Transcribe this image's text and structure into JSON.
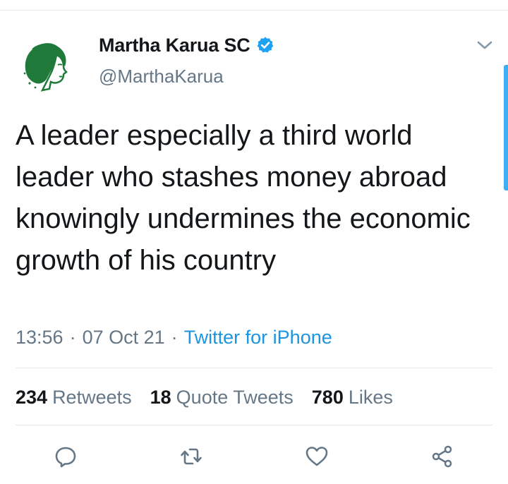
{
  "tweet": {
    "display_name": "Martha Karua SC",
    "handle": "@MarthaKarua",
    "text": "A leader especially a third world leader who stashes money abroad knowingly undermines the economic growth of his country",
    "time": "13:56",
    "date": "07 Oct 21",
    "separator": "·",
    "source": "Twitter for iPhone"
  },
  "stats": {
    "retweets": {
      "count": "234",
      "label": "Retweets"
    },
    "quote_tweets": {
      "count": "18",
      "label": "Quote Tweets"
    },
    "likes": {
      "count": "780",
      "label": "Likes"
    }
  },
  "icons": {
    "verified": "verified-badge-icon",
    "menu": "chevron-down-icon",
    "reply": "reply-icon",
    "retweet": "retweet-icon",
    "like": "heart-icon",
    "share": "share-icon"
  },
  "colors": {
    "accent": "#1da1f2",
    "link": "#1b95e0",
    "secondary_text": "#657786",
    "avatar_green": "#1f7a3a"
  }
}
